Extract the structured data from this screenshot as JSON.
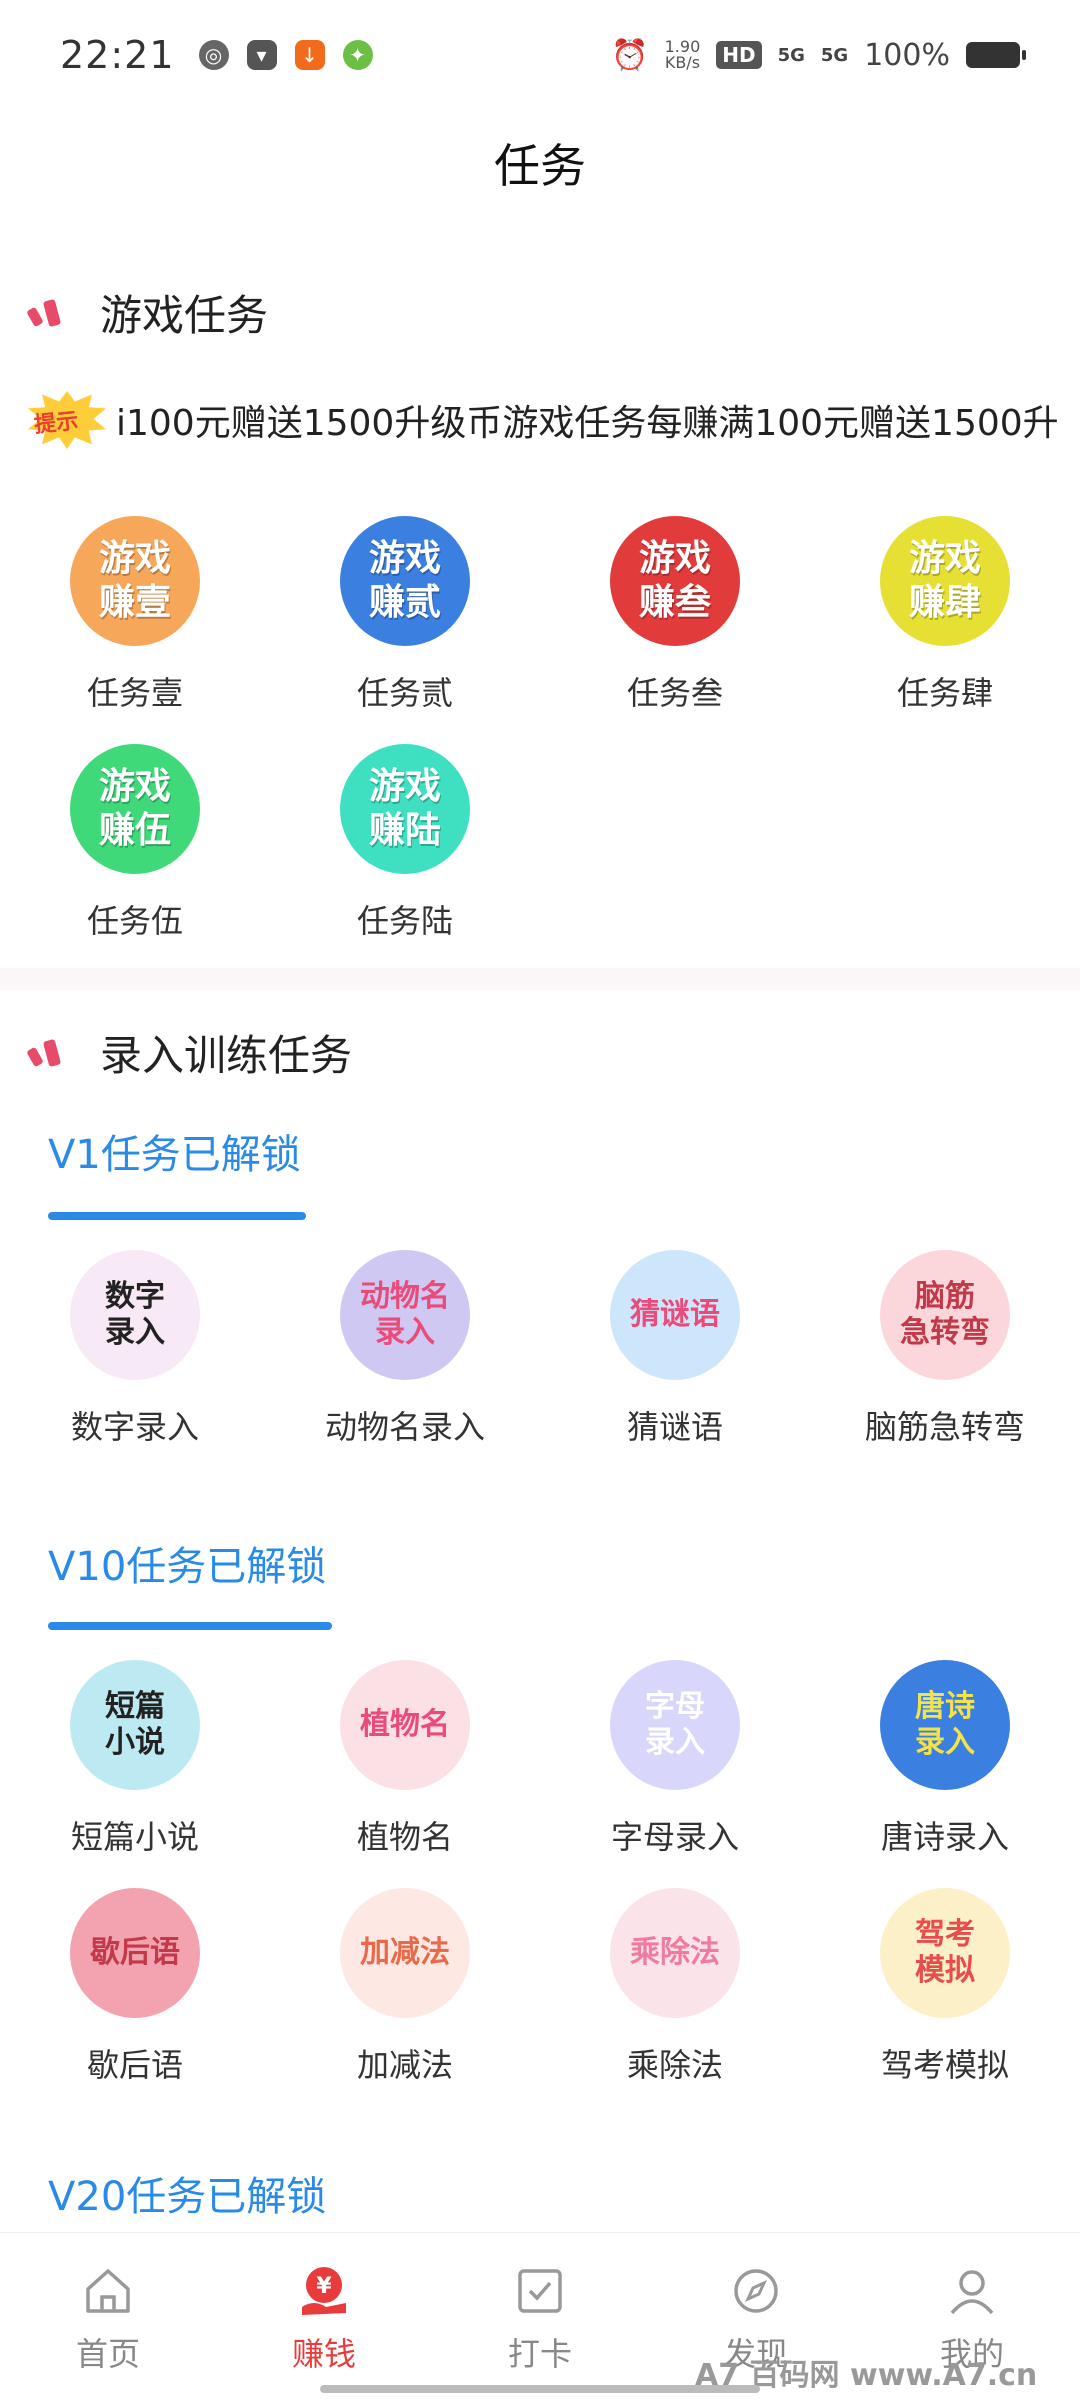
{
  "status": {
    "time": "22:21",
    "speed_top": "1.90",
    "speed_unit": "KB/s",
    "hd": "HD",
    "net1": "5G",
    "net2": "5G",
    "battery": "100%"
  },
  "header": {
    "title": "任务"
  },
  "game_section": {
    "title": "游戏任务",
    "notice_badge": "提示",
    "notice_text": "i100元赠送1500升级币游戏任务每赚满100元赠送1500升",
    "items": [
      {
        "icon_text": "游戏\n赚壹",
        "label": "任务壹",
        "color": "#f6a75a"
      },
      {
        "icon_text": "游戏\n赚贰",
        "label": "任务贰",
        "color": "#3b7fe0"
      },
      {
        "icon_text": "游戏\n赚叁",
        "label": "任务叁",
        "color": "#e23b3b"
      },
      {
        "icon_text": "游戏\n赚肆",
        "label": "任务肆",
        "color": "#e6e035"
      },
      {
        "icon_text": "游戏\n赚伍",
        "label": "任务伍",
        "color": "#3fd97a"
      },
      {
        "icon_text": "游戏\n赚陆",
        "label": "任务陆",
        "color": "#3fe0c2"
      }
    ]
  },
  "input_section": {
    "title": "录入训练任务",
    "v1": {
      "title": "V1任务已解锁",
      "items": [
        {
          "icon_text": "数字\n录入",
          "label": "数字录入",
          "bg": "#f7e9f5",
          "fg": "#222"
        },
        {
          "icon_text": "动物名\n录入",
          "label": "动物名录入",
          "bg": "#cfc8f2",
          "fg": "#e94c7a"
        },
        {
          "icon_text": "猜谜语",
          "label": "猜谜语",
          "bg": "#cde6fb",
          "fg": "#e94c7a"
        },
        {
          "icon_text": "脑筋\n急转弯",
          "label": "脑筋急转弯",
          "bg": "#fbd7db",
          "fg": "#c23a4a"
        }
      ]
    },
    "v10": {
      "title": "V10任务已解锁",
      "items": [
        {
          "icon_text": "短篇\n小说",
          "label": "短篇小说",
          "bg": "#bdeaf2",
          "fg": "#222"
        },
        {
          "icon_text": "植物名",
          "label": "植物名",
          "bg": "#fbe0e6",
          "fg": "#e94c7a"
        },
        {
          "icon_text": "字母\n录入",
          "label": "字母录入",
          "bg": "#d8d6fb",
          "fg": "#ffffff"
        },
        {
          "icon_text": "唐诗\n录入",
          "label": "唐诗录入",
          "bg": "#3b7fe0",
          "fg": "#f2e34a"
        },
        {
          "icon_text": "歇后语",
          "label": "歇后语",
          "bg": "#f3a3b0",
          "fg": "#c23a4a"
        },
        {
          "icon_text": "加减法",
          "label": "加减法",
          "bg": "#fde8e3",
          "fg": "#e86a4a"
        },
        {
          "icon_text": "乘除法",
          "label": "乘除法",
          "bg": "#fbe3ea",
          "fg": "#f07aa0"
        },
        {
          "icon_text": "驾考\n模拟",
          "label": "驾考模拟",
          "bg": "#fbf0c8",
          "fg": "#e94c4c"
        }
      ]
    },
    "v20": {
      "title": "V20任务已解锁"
    }
  },
  "bottom_nav": [
    {
      "label": "首页",
      "icon": "home-icon",
      "active": false
    },
    {
      "label": "赚钱",
      "icon": "money-icon",
      "active": true
    },
    {
      "label": "打卡",
      "icon": "checkin-icon",
      "active": false
    },
    {
      "label": "发现",
      "icon": "discover-icon",
      "active": false
    },
    {
      "label": "我的",
      "icon": "profile-icon",
      "active": false
    }
  ],
  "watermark": "A7 百码网  www.A7.cn"
}
